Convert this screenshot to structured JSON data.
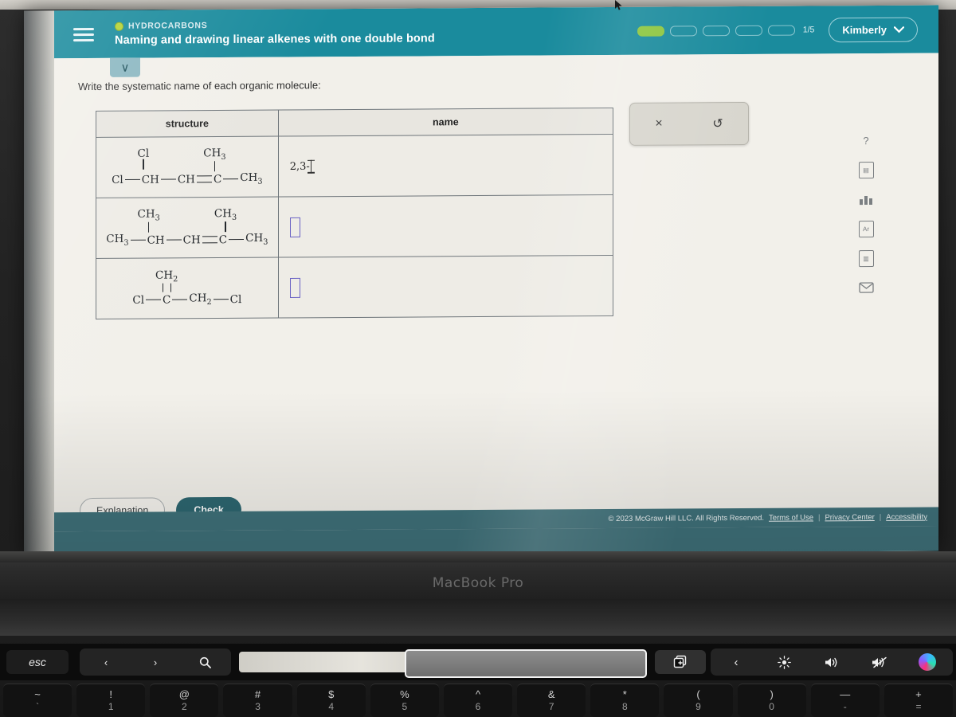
{
  "browser_sliver": {
    "left_text": "",
    "right_text": ""
  },
  "header": {
    "menu_icon": "hamburger-icon",
    "eyebrow": "HYDROCARBONS",
    "title": "Naming and drawing linear alkenes with one double bond",
    "progress": {
      "segments": 5,
      "filled": 1,
      "label": "1/5"
    },
    "user": {
      "name": "Kimberly",
      "chevron": "⌄"
    }
  },
  "content": {
    "tab_chevron": "∨",
    "prompt": "Write the systematic name of each organic molecule:",
    "table": {
      "headers": [
        "structure",
        "name"
      ],
      "rows": [
        {
          "structure": {
            "upper_left": {
              "label": "Cl",
              "bond": "single"
            },
            "upper_right": {
              "label": "CH3",
              "bond": "single"
            },
            "chain": [
              "Cl",
              "CH",
              "CH",
              "C",
              "CH3"
            ],
            "bonds": [
              "single",
              "single",
              "double",
              "single"
            ]
          },
          "answer": {
            "value": "2,3-",
            "state": "typing"
          }
        },
        {
          "structure": {
            "upper_left": {
              "label": "CH3",
              "bond": "single"
            },
            "upper_right": {
              "label": "CH3",
              "bond": "single"
            },
            "chain": [
              "CH3",
              "CH",
              "CH",
              "C",
              "CH3"
            ],
            "bonds": [
              "single",
              "single",
              "double",
              "single"
            ]
          },
          "answer": {
            "value": "",
            "state": "empty"
          }
        },
        {
          "structure": {
            "upper_left": {
              "label": "",
              "bond": "none"
            },
            "upper_right": {
              "label": "CH2",
              "bond": "double"
            },
            "chain": [
              "Cl",
              "C",
              "CH2",
              "Cl"
            ],
            "bonds": [
              "single",
              "single",
              "single"
            ]
          },
          "answer": {
            "value": "",
            "state": "empty"
          }
        }
      ]
    },
    "palette": {
      "clear_icon": "×",
      "undo_icon": "↺"
    },
    "rail": [
      {
        "name": "help-icon",
        "glyph": "?"
      },
      {
        "name": "calculator-icon",
        "glyph": "▦"
      },
      {
        "name": "bar-chart-icon",
        "glyph": "▃▇▅"
      },
      {
        "name": "periodic-table-icon",
        "glyph": "Ar"
      },
      {
        "name": "reference-book-icon",
        "glyph": "▥"
      },
      {
        "name": "message-icon",
        "glyph": "✉"
      }
    ],
    "buttons": {
      "explanation": "Explanation",
      "check": "Check"
    }
  },
  "footer": {
    "copyright": "© 2023 McGraw Hill LLC. All Rights Reserved.",
    "links": [
      "Terms of Use",
      "Privacy Center",
      "Accessibility"
    ],
    "separator": "|"
  },
  "laptop": {
    "brand": "MacBook Pro",
    "touchbar": {
      "esc": "esc",
      "back": "‹",
      "forward": "›",
      "search": "search-icon",
      "addtab": "⧉",
      "collapse": "‹",
      "brightness": "☀",
      "volume": "◂))",
      "mute": "◂̸",
      "siri": "siri-icon"
    },
    "keys": [
      {
        "top": "~",
        "bottom": "`"
      },
      {
        "top": "!",
        "bottom": "1"
      },
      {
        "top": "@",
        "bottom": "2"
      },
      {
        "top": "#",
        "bottom": "3"
      },
      {
        "top": "$",
        "bottom": "4"
      },
      {
        "top": "%",
        "bottom": "5"
      },
      {
        "top": "^",
        "bottom": "6"
      },
      {
        "top": "&",
        "bottom": "7"
      },
      {
        "top": "*",
        "bottom": "8"
      },
      {
        "top": "(",
        "bottom": "9"
      },
      {
        "top": ")",
        "bottom": "0"
      },
      {
        "top": "—",
        "bottom": "-"
      },
      {
        "top": "+",
        "bottom": "="
      }
    ]
  },
  "colors": {
    "header_teal": "#1a8b9d",
    "progress_green": "#8dc63f",
    "check_button": "#2d6670",
    "footer_teal": "#3f717a",
    "input_border": "#6b63c4"
  }
}
